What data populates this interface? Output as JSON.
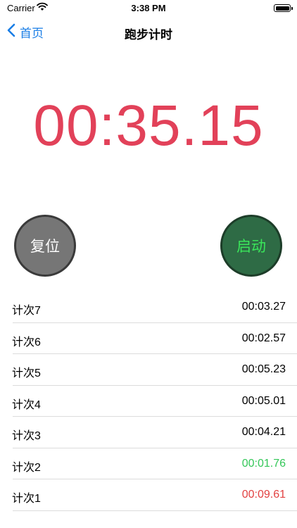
{
  "status_bar": {
    "carrier": "Carrier",
    "time": "3:38 PM"
  },
  "nav": {
    "back_label": "首页",
    "title": "跑步计时"
  },
  "timer": {
    "display": "00:35.15",
    "color": "#e24159"
  },
  "controls": {
    "reset_label": "复位",
    "start_label": "启动"
  },
  "colors": {
    "accent": "#1a7ee6",
    "fastest": "#34c759",
    "slowest": "#e24141"
  },
  "laps": [
    {
      "label": "计次7",
      "time": "00:03.27",
      "highlight": "none"
    },
    {
      "label": "计次6",
      "time": "00:02.57",
      "highlight": "none"
    },
    {
      "label": "计次5",
      "time": "00:05.23",
      "highlight": "none"
    },
    {
      "label": "计次4",
      "time": "00:05.01",
      "highlight": "none"
    },
    {
      "label": "计次3",
      "time": "00:04.21",
      "highlight": "none"
    },
    {
      "label": "计次2",
      "time": "00:01.76",
      "highlight": "fastest"
    },
    {
      "label": "计次1",
      "time": "00:09.61",
      "highlight": "slowest"
    }
  ]
}
